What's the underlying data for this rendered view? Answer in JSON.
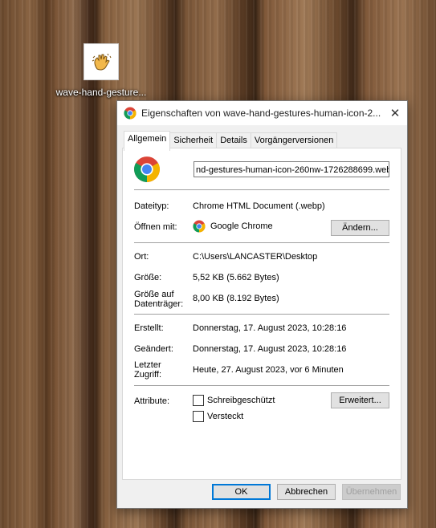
{
  "desktop": {
    "icon_label": "wave-hand-gesture..."
  },
  "window": {
    "title": "Eigenschaften von wave-hand-gestures-human-icon-2...",
    "close_symbol": "✕",
    "tabs": [
      {
        "label": "Allgemein",
        "active": true
      },
      {
        "label": "Sicherheit",
        "active": false
      },
      {
        "label": "Details",
        "active": false
      },
      {
        "label": "Vorgängerversionen",
        "active": false
      }
    ],
    "filename_value": "nd-gestures-human-icon-260nw-1726288699.webp",
    "rows": {
      "type_label": "Dateityp:",
      "type_value": "Chrome HTML Document (.webp)",
      "opens_label": "Öffnen mit:",
      "opens_value": "Google Chrome",
      "change_button": "Ändern...",
      "location_label": "Ort:",
      "location_value": "C:\\Users\\LANCASTER\\Desktop",
      "size_label": "Größe:",
      "size_value": "5,52 KB (5.662 Bytes)",
      "size_disk_label_1": "Größe auf",
      "size_disk_label_2": "Datenträger:",
      "size_disk_value": "8,00 KB (8.192 Bytes)",
      "created_label": "Erstellt:",
      "created_value": "Donnerstag, 17. August 2023, 10:28:16",
      "modified_label": "Geändert:",
      "modified_value": "Donnerstag, 17. August 2023, 10:28:16",
      "accessed_label_1": "Letzter",
      "accessed_label_2": "Zugriff:",
      "accessed_value": "Heute, 27. August 2023, vor 6 Minuten",
      "attributes_label": "Attribute:",
      "readonly_label": "Schreibgeschützt",
      "hidden_label": "Versteckt",
      "advanced_button": "Erweitert..."
    },
    "footer": {
      "ok": "OK",
      "cancel": "Abbrechen",
      "apply": "Übernehmen"
    }
  },
  "colors": {
    "chrome_red": "#db4437",
    "chrome_yellow": "#f4b400",
    "chrome_green": "#0f9d58",
    "chrome_blue": "#4285f4",
    "accent": "#0078d7"
  }
}
